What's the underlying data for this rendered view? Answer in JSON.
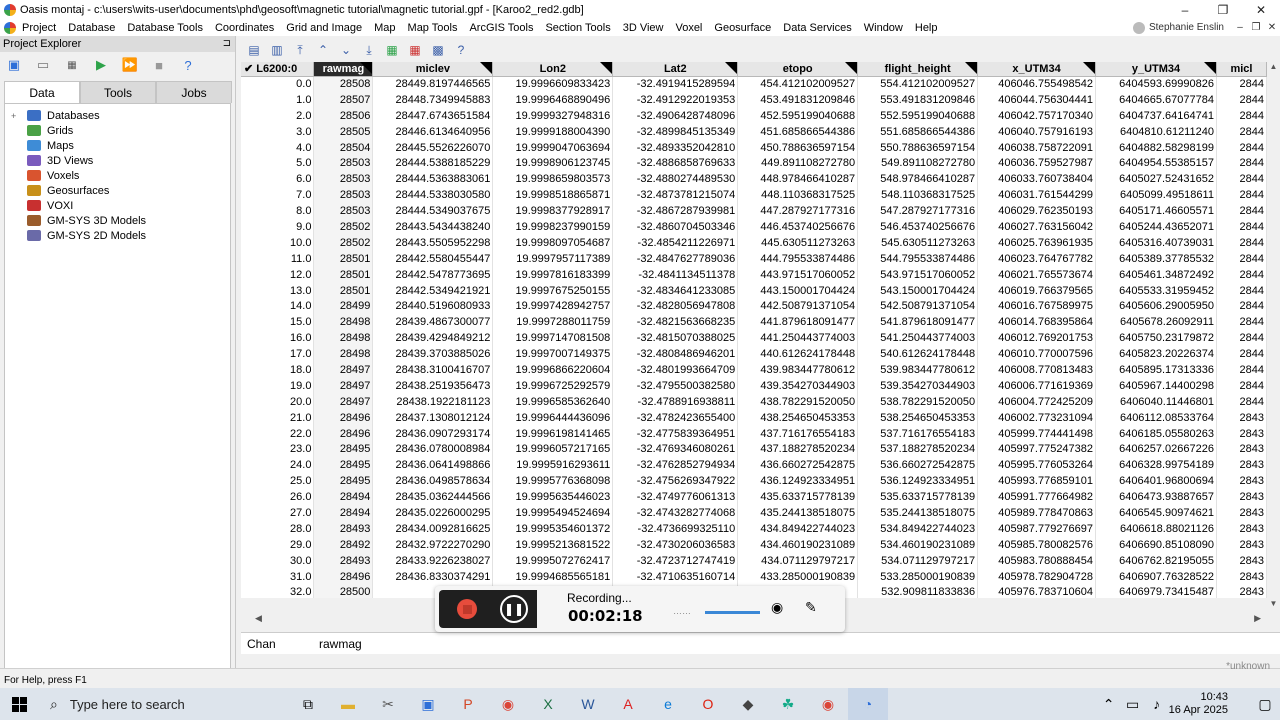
{
  "window": {
    "title": "Oasis montaj - c:\\users\\wits-user\\documents\\phd\\geosoft\\magnetic tutorial\\magnetic tutorial.gpf - [Karoo2_red2.gdb]",
    "minimize": "–",
    "restore": "❐",
    "close": "✕"
  },
  "menu": {
    "items": [
      "Project",
      "Database",
      "Database Tools",
      "Coordinates",
      "Grid and Image",
      "Map",
      "Map Tools",
      "ArcGIS Tools",
      "Section Tools",
      "3D View",
      "Voxel",
      "Geosurface",
      "Data Services",
      "Window",
      "Help"
    ],
    "user_name": "Stephanie Enslin",
    "doc_min": "–",
    "doc_restore": "❐",
    "doc_close": "✕"
  },
  "explorer": {
    "title": "Project Explorer",
    "pin": "⊐",
    "tabs": [
      "Data",
      "Tools",
      "Jobs"
    ],
    "tree": [
      {
        "label": "Databases",
        "color": "#3b6fc4",
        "expand": "+"
      },
      {
        "label": "Grids",
        "color": "#4aa146",
        "expand": ""
      },
      {
        "label": "Maps",
        "color": "#3e8cd6",
        "expand": ""
      },
      {
        "label": "3D Views",
        "color": "#7a5bbd",
        "expand": ""
      },
      {
        "label": "Voxels",
        "color": "#d9542f",
        "expand": ""
      },
      {
        "label": "Geosurfaces",
        "color": "#c8901a",
        "expand": ""
      },
      {
        "label": "VOXI",
        "color": "#c83030",
        "expand": ""
      },
      {
        "label": "GM-SYS 3D Models",
        "color": "#9a5c2c",
        "expand": ""
      },
      {
        "label": "GM-SYS 2D Models",
        "color": "#6a6aa8",
        "expand": ""
      }
    ]
  },
  "grid": {
    "line_label": "✔ L6200:0",
    "columns": [
      "rawmag",
      "miclev",
      "Lon2",
      "Lat2",
      "etopo",
      "flight_height",
      "x_UTM34",
      "y_UTM34",
      "micl"
    ],
    "rows": [
      [
        "0.0",
        "28508",
        "28449.8197446565",
        "19.9996609833423",
        "-32.4919415289594",
        "454.412102009527",
        "554.412102009527",
        "406046.755498542",
        "6404593.69990826",
        "2844"
      ],
      [
        "1.0",
        "28507",
        "28448.7349945883",
        "19.9996468890496",
        "-32.4912922019353",
        "453.491831209846",
        "553.491831209846",
        "406044.756304441",
        "6404665.67077784",
        "2844"
      ],
      [
        "2.0",
        "28506",
        "28447.6743651584",
        "19.9999327948316",
        "-32.4906428748096",
        "452.595199040688",
        "552.595199040688",
        "406042.757170340",
        "6404737.64164741",
        "2844"
      ],
      [
        "3.0",
        "28505",
        "28446.6134640956",
        "19.9999188004390",
        "-32.4899845135349",
        "451.685866544386",
        "551.685866544386",
        "406040.757916193",
        "6404810.61211240",
        "2844"
      ],
      [
        "4.0",
        "28504",
        "28445.5526226070",
        "19.9999047063694",
        "-32.4893352042810",
        "450.788636597154",
        "550.788636597154",
        "406038.758722091",
        "6404882.58298199",
        "2844"
      ],
      [
        "5.0",
        "28503",
        "28444.5388185229",
        "19.9998906123745",
        "-32.4886858769633",
        "449.891108272780",
        "549.891108272780",
        "406036.759527987",
        "6404954.55385157",
        "2844"
      ],
      [
        "6.0",
        "28503",
        "28444.5363883061",
        "19.9998659803573",
        "-32.4880274489530",
        "448.978466410287",
        "548.978466410287",
        "406033.760738404",
        "6405027.52431652",
        "2844"
      ],
      [
        "7.0",
        "28503",
        "28444.5338030580",
        "19.9998518865871",
        "-32.4873781215074",
        "448.110368317525",
        "548.110368317525",
        "406031.761544299",
        "6405099.49518611",
        "2844"
      ],
      [
        "8.0",
        "28503",
        "28444.5349037675",
        "19.9998377928917",
        "-32.4867287939981",
        "447.287927177316",
        "547.287927177316",
        "406029.762350193",
        "6405171.46605571",
        "2844"
      ],
      [
        "9.0",
        "28502",
        "28443.5434438240",
        "19.9998237990159",
        "-32.4860704503346",
        "446.453740256676",
        "546.453740256676",
        "406027.763156042",
        "6405244.43652071",
        "2844"
      ],
      [
        "10.0",
        "28502",
        "28443.5505952298",
        "19.9998097054687",
        "-32.4854211226971",
        "445.630511273263",
        "545.630511273263",
        "406025.763961935",
        "6405316.40739031",
        "2844"
      ],
      [
        "11.0",
        "28501",
        "28442.5580455447",
        "19.9997957117389",
        "-32.4847627789036",
        "444.795533874486",
        "544.795533874486",
        "406023.764767782",
        "6405389.37785532",
        "2844"
      ],
      [
        "12.0",
        "28501",
        "28442.5478773695",
        "19.9997816183399",
        "-32.4841134511378",
        "443.971517060052",
        "543.971517060052",
        "406021.765573674",
        "6405461.34872492",
        "2844"
      ],
      [
        "13.0",
        "28501",
        "28442.5349421921",
        "19.9997675250155",
        "-32.4834641233085",
        "443.150001704424",
        "543.150001704424",
        "406019.766379565",
        "6405533.31959452",
        "2844"
      ],
      [
        "14.0",
        "28499",
        "28440.5196080933",
        "19.9997428942757",
        "-32.4828056947808",
        "442.508791371054",
        "542.508791371054",
        "406016.767589975",
        "6405606.29005950",
        "2844"
      ],
      [
        "15.0",
        "28498",
        "28439.4867300077",
        "19.9997288011759",
        "-32.4821563668235",
        "441.879618091477",
        "541.879618091477",
        "406014.768395864",
        "6405678.26092911",
        "2844"
      ],
      [
        "16.0",
        "28498",
        "28439.4294849212",
        "19.9997147081508",
        "-32.4815070388025",
        "441.250443774003",
        "541.250443774003",
        "406012.769201753",
        "6405750.23179872",
        "2844"
      ],
      [
        "17.0",
        "28498",
        "28439.3703885026",
        "19.9997007149375",
        "-32.4808486946201",
        "440.612624178448",
        "540.612624178448",
        "406010.770007596",
        "6405823.20226374",
        "2844"
      ],
      [
        "18.0",
        "28497",
        "28438.3100416707",
        "19.9996866220604",
        "-32.4801993664709",
        "439.983447780612",
        "539.983447780612",
        "406008.770813483",
        "6405895.17313336",
        "2844"
      ],
      [
        "19.0",
        "28497",
        "28438.2519356473",
        "19.9996725292579",
        "-32.4795500382580",
        "439.354270344903",
        "539.354270344903",
        "406006.771619369",
        "6405967.14400298",
        "2844"
      ],
      [
        "20.0",
        "28497",
        "28438.1922181123",
        "19.9996585362640",
        "-32.4788916938811",
        "438.782291520050",
        "538.782291520050",
        "406004.772425209",
        "6406040.11446801",
        "2844"
      ],
      [
        "21.0",
        "28496",
        "28437.1308012124",
        "19.9996444436096",
        "-32.4782423655400",
        "438.254650453353",
        "538.254650453353",
        "406002.773231094",
        "6406112.08533764",
        "2843"
      ],
      [
        "22.0",
        "28496",
        "28436.0907293174",
        "19.9996198141465",
        "-32.4775839364951",
        "437.716176554183",
        "537.716176554183",
        "405999.774441498",
        "6406185.05580263",
        "2843"
      ],
      [
        "23.0",
        "28495",
        "28436.0780008984",
        "19.9996057217165",
        "-32.4769346080261",
        "437.188278520234",
        "537.188278520234",
        "405997.775247382",
        "6406257.02667226",
        "2843"
      ],
      [
        "24.0",
        "28495",
        "28436.0641498866",
        "19.9995916293611",
        "-32.4762852794934",
        "436.660272542875",
        "536.660272542875",
        "405995.776053264",
        "6406328.99754189",
        "2843"
      ],
      [
        "25.0",
        "28495",
        "28436.0498578634",
        "19.9995776368098",
        "-32.4756269347922",
        "436.124923334951",
        "536.124923334951",
        "405993.776859101",
        "6406401.96800694",
        "2843"
      ],
      [
        "26.0",
        "28494",
        "28435.0362444566",
        "19.9995635446023",
        "-32.4749776061313",
        "435.633715778139",
        "535.633715778139",
        "405991.777664982",
        "6406473.93887657",
        "2843"
      ],
      [
        "27.0",
        "28494",
        "28435.0226000295",
        "19.9995494524694",
        "-32.4743282774068",
        "435.244138518075",
        "535.244138518075",
        "405989.778470863",
        "6406545.90974621",
        "2843"
      ],
      [
        "28.0",
        "28493",
        "28434.0092816625",
        "19.9995354601372",
        "-32.4736699325110",
        "434.849422744023",
        "534.849422744023",
        "405987.779276697",
        "6406618.88021126",
        "2843"
      ],
      [
        "29.0",
        "28492",
        "28432.9722270290",
        "19.9995213681522",
        "-32.4730206036583",
        "434.460190231089",
        "534.460190231089",
        "405985.780082576",
        "6406690.85108090",
        "2843"
      ],
      [
        "30.0",
        "28493",
        "28433.9226238027",
        "19.9995072762417",
        "-32.4723712747419",
        "434.071129797217",
        "534.071129797217",
        "405983.780888454",
        "6406762.82195055",
        "2843"
      ],
      [
        "31.0",
        "28496",
        "28436.8330374291",
        "19.9994685565181",
        "-32.4710635160714",
        "433.285000190839",
        "533.285000190839",
        "405978.782904728",
        "6406907.76328522",
        "2843"
      ],
      [
        "32.0",
        "28500",
        "28440.",
        "",
        "",
        "",
        "532.909811833836",
        "405976.783710604",
        "6406979.73415487",
        "2843"
      ]
    ]
  },
  "chan": {
    "label": "Chan",
    "value": "rawmag"
  },
  "status": {
    "help": "For Help, press F1",
    "unknown": "*unknown"
  },
  "recorder": {
    "label": "Recording...",
    "time": "00:02:18"
  },
  "taskbar": {
    "search_placeholder": "Type here to search",
    "time": "10:43",
    "date": "16 Apr 2025"
  }
}
